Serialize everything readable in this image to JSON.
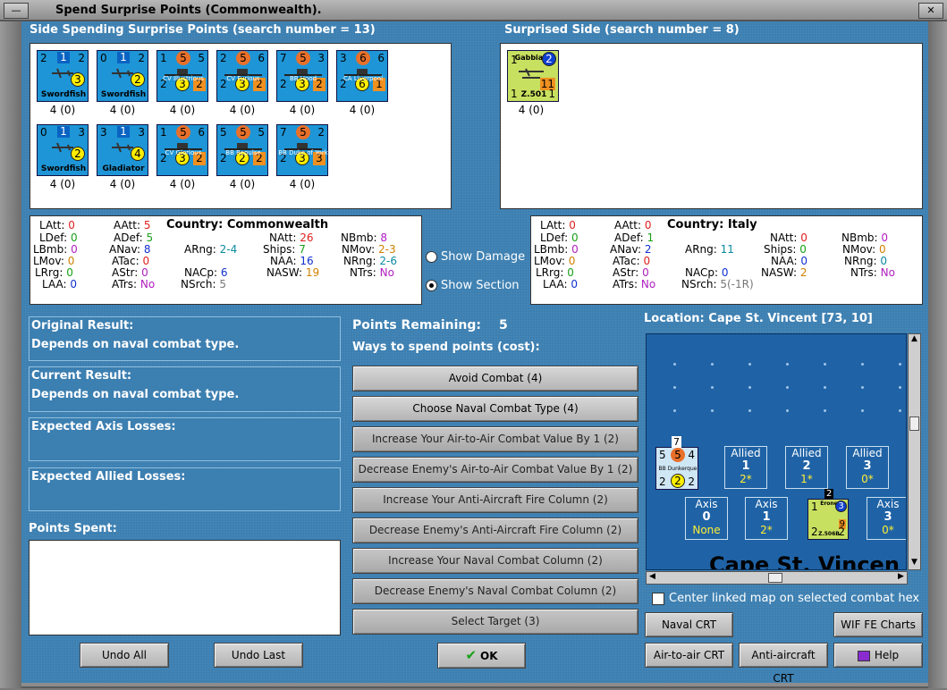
{
  "window": {
    "title": "Spend Surprise Points (Commonwealth)."
  },
  "spending_side": {
    "header": "Side Spending Surprise Points (search number = 13)",
    "units": [
      {
        "name": "Swordfish",
        "tl": "2",
        "mid": "1",
        "tr": "2",
        "circ": "3",
        "caption": "4 (0)"
      },
      {
        "name": "Swordfish",
        "tl": "0",
        "mid": "1",
        "tr": "2",
        "circ": "2",
        "caption": "4 (0)"
      },
      {
        "name": "CV Illustrious",
        "tl": "1",
        "mid": "5",
        "tr": "5",
        "bl": "2",
        "bm": "3",
        "br": "2",
        "caption": "4 (0)"
      },
      {
        "name": "CV Furious",
        "tl": "2",
        "mid": "5",
        "tr": "6",
        "bl": "2",
        "bm": "3",
        "br": "2",
        "caption": "4 (0)"
      },
      {
        "name": "BB Hood",
        "tl": "7",
        "mid": "5",
        "tr": "3",
        "bl": "2",
        "bm": "3",
        "br": "2",
        "caption": "4 (0)"
      },
      {
        "name": "CA Liverpool",
        "tl": "3",
        "mid": "6",
        "tr": "6",
        "bl": "2",
        "bm": "6",
        "br": "1",
        "caption": "4 (0)"
      },
      {
        "name": "Swordfish",
        "tl": "0",
        "mid": "1",
        "tr": "3",
        "circ": "2",
        "caption": "4 (0)"
      },
      {
        "name": "Gladiator",
        "tl": "3",
        "mid": "1",
        "tr": "3",
        "circ": "4",
        "caption": "4 (0)"
      },
      {
        "name": "CV Glorious",
        "tl": "1",
        "mid": "5",
        "tr": "6",
        "bl": "2",
        "bm": "3",
        "br": "2",
        "caption": "4 (0)"
      },
      {
        "name": "BB Repulse",
        "tl": "5",
        "mid": "5",
        "tr": "5",
        "bl": "2",
        "bm": "2",
        "br": "2",
        "caption": "4 (0)"
      },
      {
        "name": "BB Duke of York",
        "tl": "7",
        "mid": "5",
        "tr": "2",
        "bl": "2",
        "bm": "3",
        "br": "3",
        "caption": "4 (0)"
      }
    ]
  },
  "surprised_side": {
    "header": "Surprised Side (search number = 8)",
    "units": [
      {
        "name": "Z.501",
        "tl": "1",
        "label": "Gabbiano",
        "circ": "2",
        "val1": "11",
        "bl": "1",
        "br": "1",
        "caption": "4 (0)"
      }
    ]
  },
  "stats_left": {
    "country_label": "Country:",
    "country": "Commonwealth",
    "rows": [
      [
        "LAtt:",
        "0",
        "AAtt:",
        "5",
        "NAtt:",
        "26",
        "NBmb:",
        "8"
      ],
      [
        "LDef:",
        "0",
        "ADef:",
        "5",
        "",
        "",
        "",
        ""
      ],
      [
        "LBmb:",
        "0",
        "ANav:",
        "8",
        "ARng:",
        "2-4",
        "Ships:",
        "7",
        "NMov:",
        "2-3"
      ],
      [
        "LMov:",
        "0",
        "ATac:",
        "0",
        "NAA:",
        "16",
        "NRng:",
        "2-6"
      ],
      [
        "LRrg:",
        "0",
        "AStr:",
        "0",
        "NACp:",
        "6",
        "NASW:",
        "19",
        "NTrs:",
        "No"
      ],
      [
        "LAA:",
        "0",
        "ATrs:",
        "No",
        "NSrch:",
        "5"
      ]
    ]
  },
  "stats_right": {
    "country_label": "Country:",
    "country": "Italy",
    "LAtt": "0",
    "AAtt": "0",
    "NAtt": "0",
    "NBmb": "0",
    "LDef": "0",
    "ADef": "1",
    "LBmb": "0",
    "ANav": "2",
    "ARng": "11",
    "Ships": "0",
    "NMov": "0",
    "LMov": "0",
    "ATac": "0",
    "NAA": "0",
    "NRng": "0",
    "LRrg": "0",
    "AStr": "0",
    "NACp": "0",
    "NASW": "2",
    "NTrs": "No",
    "LAA": "0",
    "ATrs": "No",
    "NSrch": "5(-1R)"
  },
  "stats_left_vals": {
    "LAtt": "0",
    "AAtt": "5",
    "NAtt": "26",
    "NBmb": "8",
    "LDef": "0",
    "ADef": "5",
    "LBmb": "0",
    "ANav": "8",
    "ARng": "2-4",
    "Ships": "7",
    "NMov": "2-3",
    "LMov": "0",
    "ATac": "0",
    "NAA": "16",
    "NRng": "2-6",
    "LRrg": "0",
    "AStr": "0",
    "NACp": "6",
    "NASW": "19",
    "NTrs": "No",
    "LAA": "0",
    "ATrs": "No",
    "NSrch": "5"
  },
  "toggles": {
    "show_damage": "Show Damage",
    "show_section": "Show Section",
    "selected": "show_section"
  },
  "results": {
    "original_label": "Original Result:",
    "original_value": "Depends on naval combat type.",
    "current_label": "Current Result:",
    "current_value": "Depends on naval combat type.",
    "axis_losses_label": "Expected Axis Losses:",
    "allied_losses_label": "Expected Allied Losses:",
    "points_spent_label": "Points Spent:"
  },
  "points": {
    "remaining_label": "Points Remaining:",
    "remaining_value": "5",
    "ways_label": "Ways to spend points (cost):",
    "options": [
      {
        "label": "Avoid Combat (4)",
        "enabled": true
      },
      {
        "label": "Choose Naval Combat Type (4)",
        "enabled": true
      },
      {
        "label": "Increase Your Air-to-Air Combat Value By 1 (2)",
        "enabled": false
      },
      {
        "label": "Decrease Enemy's Air-to-Air Combat Value By 1 (2)",
        "enabled": false
      },
      {
        "label": "Increase Your Anti-Aircraft Fire Column (2)",
        "enabled": false
      },
      {
        "label": "Decrease Enemy's Anti-Aircraft Fire Column (2)",
        "enabled": false
      },
      {
        "label": "Increase Your Naval Combat Column (2)",
        "enabled": false
      },
      {
        "label": "Decrease Enemy's Naval Combat Column (2)",
        "enabled": false
      },
      {
        "label": "Select Target (3)",
        "enabled": false
      }
    ]
  },
  "map": {
    "location": "Location: Cape St. Vincent [73, 10]",
    "map_label": "Cape St. Vincen",
    "allied_boxes": [
      {
        "label": "Allied",
        "num": "1",
        "sub": "2*"
      },
      {
        "label": "Allied",
        "num": "2",
        "sub": "1*"
      },
      {
        "label": "Allied",
        "num": "3",
        "sub": "0*"
      }
    ],
    "axis_boxes": [
      {
        "label": "Axis",
        "num": "0",
        "sub": "None"
      },
      {
        "label": "Axis",
        "num": "1",
        "sub": "2*"
      },
      {
        "label": "Axis",
        "num": "3",
        "sub": "0*"
      }
    ],
    "ship_counter": {
      "name": "BB Dunkerque",
      "tl": "5",
      "mid": "5",
      "tr": "4",
      "top": "7",
      "bl": "2",
      "bm": "2",
      "br": "2"
    },
    "air_counter": {
      "name": "Z.506B",
      "label": "Erone",
      "top": "2",
      "tl": "1",
      "circ": "3",
      "val1": "9",
      "bl": "2",
      "br": "2"
    },
    "center_checkbox_label": "Center linked map on selected combat hex"
  },
  "buttons": {
    "undo_all": "Undo All",
    "undo_last": "Undo Last",
    "ok": "OK",
    "naval_crt": "Naval CRT",
    "wif_fe_charts": "WIF FE Charts",
    "air_to_air_crt": "Air-to-air CRT",
    "anti_aircraft_crt": "Anti-aircraft CRT",
    "help": "Help"
  },
  "colors": {
    "background": "#3c7fb1",
    "counter_blue": "#1e95d6",
    "counter_italy": "#c8e060"
  }
}
